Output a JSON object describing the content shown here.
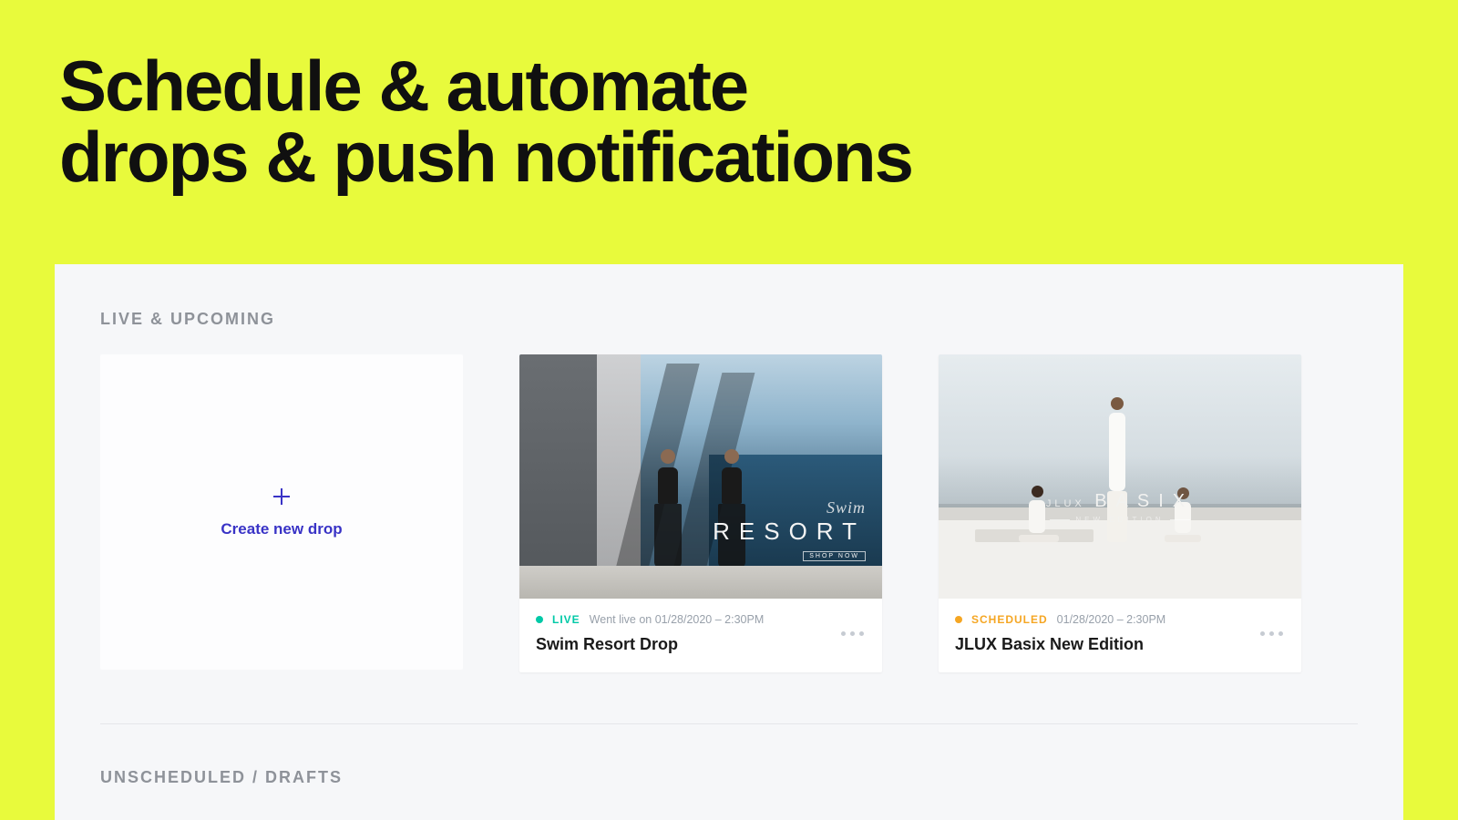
{
  "hero": {
    "title_line1": "Schedule & automate",
    "title_line2": "drops & push notifications"
  },
  "sections": {
    "live_upcoming": "LIVE & UPCOMING",
    "drafts": "UNSCHEDULED / DRAFTS"
  },
  "create_card": {
    "label": "Create new drop"
  },
  "drops": [
    {
      "status": "LIVE",
      "status_kind": "live",
      "timestamp": "Went live on 01/28/2020 – 2:30PM",
      "title": "Swim Resort Drop",
      "thumb_overlay": {
        "script": "Swim",
        "main": "RESORT",
        "cta": "SHOP NOW"
      }
    },
    {
      "status": "SCHEDULED",
      "status_kind": "scheduled",
      "timestamp": "01/28/2020 – 2:30PM",
      "title": "JLUX Basix New Edition",
      "thumb_overlay": {
        "pre": "JLUX",
        "main": "BASIX",
        "sub": "NEW EDITION"
      }
    }
  ]
}
